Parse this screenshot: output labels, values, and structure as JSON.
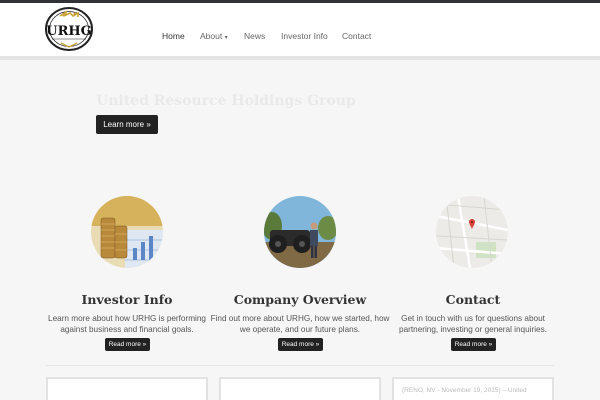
{
  "logo": {
    "text": "URHG"
  },
  "nav": {
    "items": [
      {
        "label": "Home",
        "active": true
      },
      {
        "label": "About",
        "caret": "▾"
      },
      {
        "label": "News"
      },
      {
        "label": "Investor Info"
      },
      {
        "label": "Contact"
      }
    ]
  },
  "hero": {
    "title": "United Resource Holdings Group",
    "button_label": "Learn more »"
  },
  "features": [
    {
      "title": "Investor Info",
      "text": "Learn more about how URHG is performing against business and financial goals.",
      "button_label": "Read more »",
      "image": "coins-chart-image"
    },
    {
      "title": "Company Overview",
      "text": "Find out more about URHG, how we started, how we operate, and our future plans.",
      "button_label": "Read more »",
      "image": "machinery-photo"
    },
    {
      "title": "Contact",
      "text": "Get in touch with us for questions about partnering, investing or general inquiries.",
      "button_label": "Read more »",
      "image": "map-image"
    }
  ],
  "news_cards": [
    {
      "text": ""
    },
    {
      "text": ""
    },
    {
      "text": "(RENO, NV - November 19, 2015) – United"
    }
  ],
  "colors": {
    "topbar": "#2f3338",
    "button": "#222222",
    "accent_gold": "#c9a43a"
  }
}
